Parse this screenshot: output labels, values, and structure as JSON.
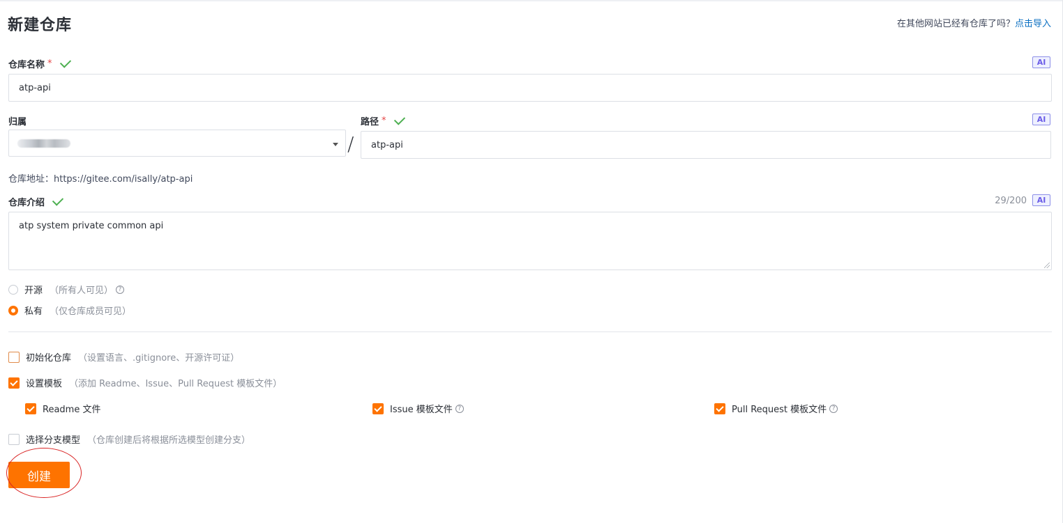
{
  "page": {
    "title": "新建仓库",
    "import_prompt": "在其他网站已经有仓库了吗？",
    "import_link": "点击导入"
  },
  "ai_badge": "AI",
  "required_mark": "*",
  "repo_name": {
    "label": "仓库名称",
    "value": "atp-api"
  },
  "owner": {
    "label": "归属"
  },
  "path": {
    "label": "路径",
    "separator": "/",
    "value": "atp-api"
  },
  "repo_address": {
    "text": "仓库地址：https://gitee.com/isally/atp-api"
  },
  "description": {
    "label": "仓库介绍",
    "counter": "29/200",
    "value": "atp system private common api"
  },
  "visibility": {
    "options": [
      {
        "label": "开源",
        "hint": "（所有人可见）",
        "selected": false
      },
      {
        "label": "私有",
        "hint": "（仅仓库成员可见）",
        "selected": true
      }
    ]
  },
  "help_glyph": "?",
  "init_repo": {
    "label": "初始化仓库",
    "hint": "（设置语言、.gitignore、开源许可证）",
    "checked": false
  },
  "templates": {
    "label": "设置模板",
    "hint": "（添加 Readme、Issue、Pull Request 模板文件）",
    "checked": true,
    "items": [
      {
        "label": "Readme 文件",
        "checked": true
      },
      {
        "label": "Issue 模板文件",
        "checked": true
      },
      {
        "label": "Pull Request 模板文件",
        "checked": true
      }
    ]
  },
  "branch_model": {
    "label": "选择分支模型",
    "hint": "（仓库创建后将根据所选模型创建分支）",
    "checked": false
  },
  "create_button": "创建",
  "colors": {
    "accent": "#fe7300",
    "success": "#4caf50",
    "required": "#e54545",
    "link": "#0a6fc2",
    "annotation": "#d92323"
  }
}
